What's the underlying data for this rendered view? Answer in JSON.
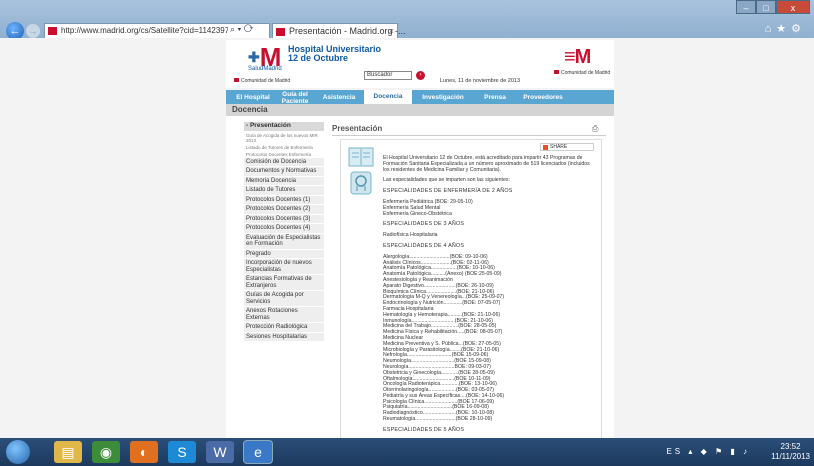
{
  "browser": {
    "url": "http://www.madrid.org/cs/Satellite?cid=114239777",
    "tab_title": "Presentación - Madrid.org -...",
    "window_buttons": [
      "–",
      "□",
      "x"
    ]
  },
  "header": {
    "hospital_line1": "Hospital Universitario",
    "hospital_line2": "12 de Octubre",
    "salud": "SaludMadrid",
    "comunidad": "Comunidad de Madrid",
    "search_value": "Buscador",
    "date": "Lunes, 11 de noviembre de 2013"
  },
  "nav": {
    "items": [
      "El Hospital",
      "Guía del Paciente",
      "Asistencia",
      "Docencia",
      "Investigación",
      "Prensa",
      "Proveedores"
    ],
    "active": "Docencia"
  },
  "section_title": "Docencia",
  "sidebar": {
    "first": "- Presentación",
    "subs": [
      "Guía de Acogida de los nuevos MIR 2013",
      "Listado de Tutores de Enfermería",
      "Protocolos Docentes Enfermería"
    ],
    "items": [
      "Comisión de Docencia",
      "Documentos y Normativas",
      "Memoria Docencia",
      "Listado de Tutores",
      "Protocolos Docentes (1)",
      "Protocolos Docentes (2)",
      "Protocolos Docentes (3)",
      "Protocolos Docentes (4)",
      "Evaluación de Especialistas en Formación",
      "Pregrado",
      "Incorporación de nuevos Especialistas",
      "Estancias Formativas de Extranjeros",
      "Guías de Acogida por Servicios",
      "Anexos Rotaciones Externas",
      "Protección Radiológica",
      "Sesiones Hospitalarias"
    ]
  },
  "main": {
    "title": "Presentación",
    "share": "SHARE",
    "intro": "El Hospital Universitario 12 de Octubre, está acreditado para impartir 43 Programas de Formación Sanitaria Especializada a un número aproximado de 519 licenciados (incluidos los residentes de Medicina Familiar y Comunitaria).",
    "intro2": "Las especialidades que se imparten son las siguientes:",
    "h_enf": "ESPECIALIDADES DE ENFERMERÍA DE 2 AÑOS",
    "enf": [
      "Enfermería Pediátrica (BOE: 29-05-10)",
      "Enfermería Salud Mental",
      "Enfermería Gineco-Obstétrica"
    ],
    "h_3": "ESPECIALIDADES DE 3 AÑOS",
    "e3": [
      "Radiofísica Hospitalaria"
    ],
    "h_4": "ESPECIALIDADES DE 4 AÑOS",
    "e4": [
      "Alergología............................(BOE: 09-10-06)",
      "Análisis Clínicos.....................(BOE: 02-11-06)",
      "Anatomía Patológica..................(BOE: 10-10-06)",
      "Anatomía Patológica..........(Anexo) (BOE:25-05-09)",
      "Anestesiología y Reanimación",
      "Aparato Digestivo......................(BOE: 26-10-09)",
      "Bioquímica Clínica.....................(BOE: 21-10-06)",
      "Dermatología M-Q y Venereología...(BOE: 25-09-07)",
      "Endocrinología y Nutrición.............(BOE: 07-05-07)",
      "Farmacia Hospitalaria",
      "Hematología y Hemoterapia..........(BOE: 21-10-06)",
      "Inmunología..............................(BOE: 21-10-06)",
      "Medicina del Trabajo...................(BOE: 28-05-05)",
      "Medicina Física y Rehabilitación.....(BOE: 08-05-07)",
      "Medicina Nuclear",
      "Medicina Preventiva y S. Pública...(BOE: 27-05-05)",
      "Microbiología y Parasitología........(BOE: 21-10-06)",
      "Nefrología...............................(BOE 15-09-06)",
      "Neumología..............................(BOE 15-09-08)",
      "Neurología................................BOE: 09-03-07)",
      "Obstetricia y Ginecología............(BOE 28-05-09)",
      "Oftalmología.............................(BOE 10-11-09)",
      "Oncología Radioterápica.............(BOE: 13-10-06)",
      "Otorrinolaringología...................(BOE: 03-05-07)",
      "Pediatría y sus Áreas Específicas....(BOE: 14-10-06)",
      "Psicología Clínica.......................(BOE 17-06-09)",
      "Psiquiatría...............................(BOE 16-09-08)",
      "Radiodiagnóstico.......................(BOE: 10-10-08)",
      "Reumatología............................(BOE 28-10-09)"
    ],
    "h_5": "ESPECIALIDADES DE 5 AÑOS"
  },
  "taskbar": {
    "lang": "ES",
    "time": "23:52",
    "date": "11/11/2013"
  }
}
